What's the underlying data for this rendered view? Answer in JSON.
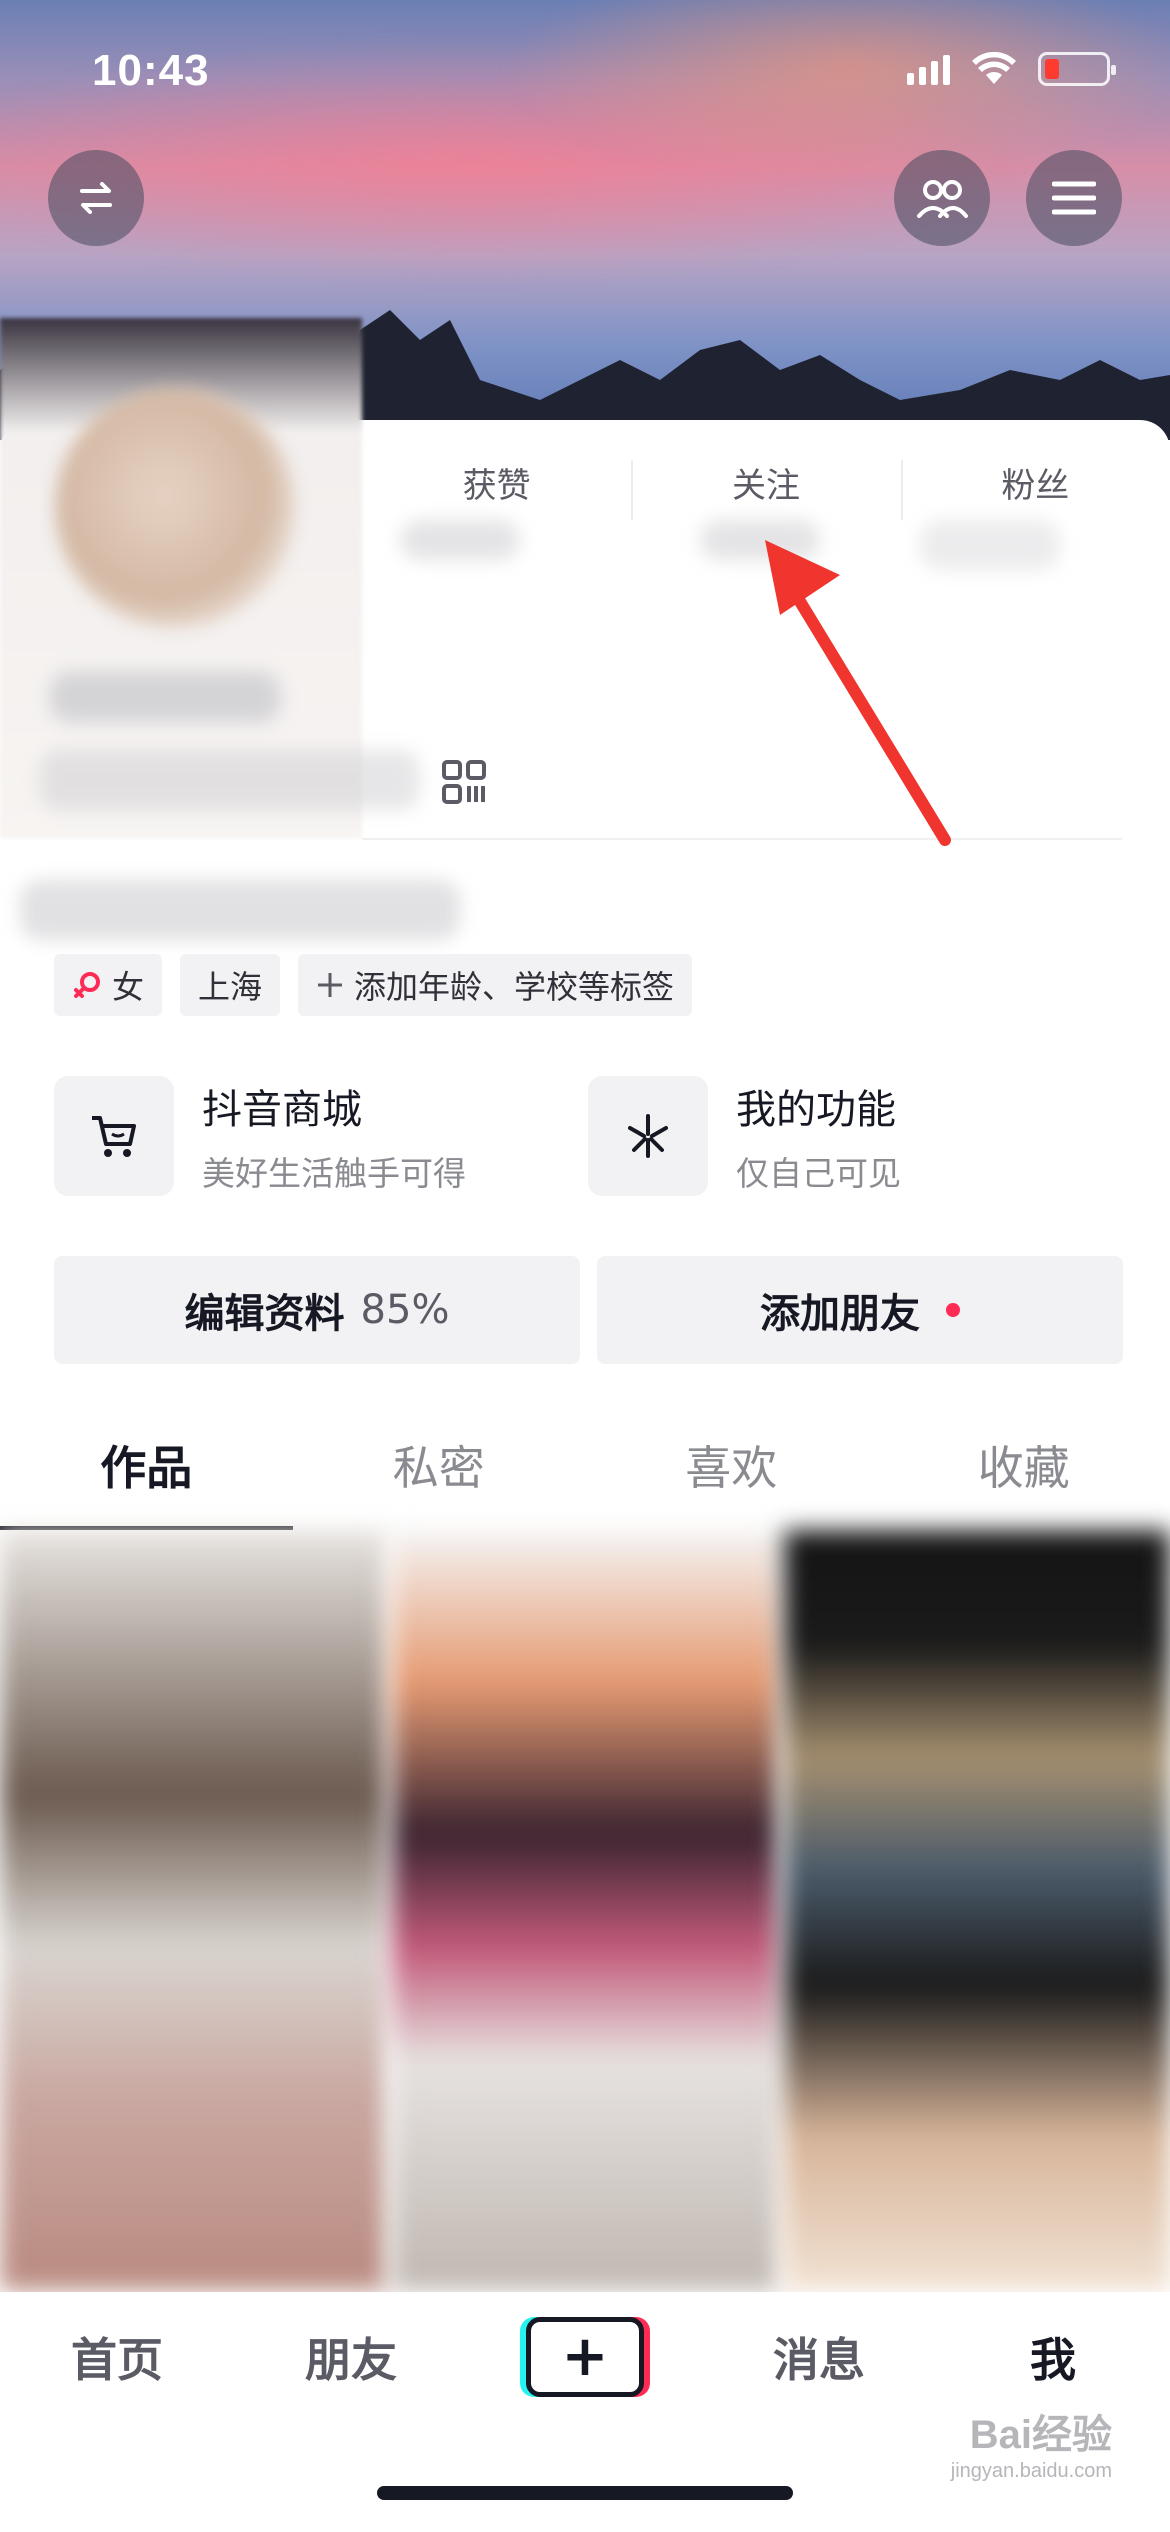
{
  "status_bar": {
    "time": "10:43"
  },
  "stats": [
    {
      "label": "获赞"
    },
    {
      "label": "关注"
    },
    {
      "label": "粉丝"
    }
  ],
  "tags": [
    {
      "label": "女",
      "icon": "female-icon"
    },
    {
      "label": "上海"
    },
    {
      "label": "添加年龄、学校等标签",
      "icon": "plus-icon"
    }
  ],
  "features": [
    {
      "title": "抖音商城",
      "subtitle": "美好生活触手可得",
      "icon": "cart-icon"
    },
    {
      "title": "我的功能",
      "subtitle": "仅自己可见",
      "icon": "spark-icon"
    }
  ],
  "buttons": {
    "edit_profile": "编辑资料",
    "edit_percent": "85%",
    "add_friends": "添加朋友"
  },
  "tabs": [
    "作品",
    "私密",
    "喜欢",
    "收藏"
  ],
  "active_tab": "作品",
  "nav": {
    "items": [
      "首页",
      "朋友",
      "+",
      "消息",
      "我"
    ],
    "active": "我"
  },
  "watermark": {
    "line1": "Bai经验",
    "line2": "jingyan.baidu.com"
  },
  "colors": {
    "accent_red": "#fe2c55",
    "accent_cyan": "#25f4ee",
    "annotation_arrow": "#f0352f"
  }
}
